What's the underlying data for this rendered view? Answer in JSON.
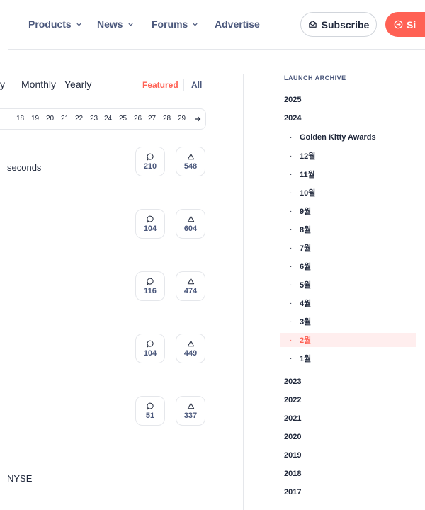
{
  "nav": {
    "items": [
      {
        "label": "Products",
        "has_chevron": true
      },
      {
        "label": "News",
        "has_chevron": true
      },
      {
        "label": "Forums",
        "has_chevron": true
      },
      {
        "label": "Advertise",
        "has_chevron": false
      }
    ],
    "subscribe_label": "Subscribe",
    "signin_label": "Si"
  },
  "feed": {
    "tabs": {
      "daily_partial": "y",
      "monthly": "Monthly",
      "yearly": "Yearly",
      "featured": "Featured",
      "all": "All"
    },
    "days": [
      "18",
      "19",
      "20",
      "21",
      "22",
      "23",
      "24",
      "25",
      "26",
      "27",
      "28",
      "29"
    ],
    "snippets": {
      "first": "seconds",
      "last": "NYSE"
    },
    "products": [
      {
        "comments": "210",
        "upvotes": "548"
      },
      {
        "comments": "104",
        "upvotes": "604"
      },
      {
        "comments": "116",
        "upvotes": "474"
      },
      {
        "comments": "104",
        "upvotes": "449"
      },
      {
        "comments": "51",
        "upvotes": "337"
      }
    ]
  },
  "archive": {
    "title": "LAUNCH ARCHIVE",
    "year_2025": "2025",
    "year_2024": "2024",
    "months": [
      "Golden Kitty Awards",
      "12월",
      "11월",
      "10월",
      "9월",
      "8월",
      "7월",
      "6월",
      "5월",
      "4월",
      "3월",
      "2월",
      "1월"
    ],
    "active_month": "2월",
    "older_years": [
      "2023",
      "2022",
      "2021",
      "2020",
      "2019",
      "2018",
      "2017"
    ]
  },
  "colors": {
    "accent": "#ff6154",
    "text": "#21293c",
    "muted": "#4b587c",
    "border": "#e5e7eb",
    "active_bg": "#ffeeee"
  }
}
